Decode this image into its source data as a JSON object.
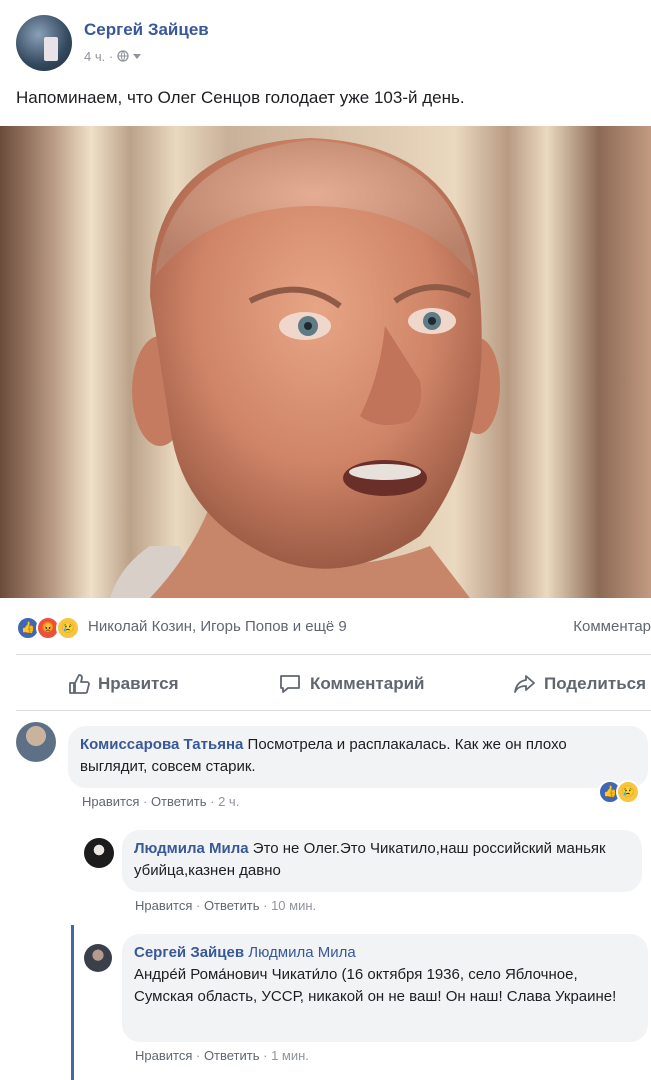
{
  "post": {
    "author": "Сергей Зайцев",
    "time": "4 ч.",
    "privacy_icon": "globe-icon",
    "text": "Напоминаем, что Олег Сенцов голодает уже 103-й день."
  },
  "reactions": {
    "icons": [
      "like-reaction-icon",
      "angry-reaction-icon",
      "sad-reaction-icon"
    ],
    "names": "Николай Козин, Игорь Попов и ещё 9",
    "comments_link": "Комментар"
  },
  "actions": {
    "like": "Нравится",
    "comment": "Комментарий",
    "share": "Поделиться"
  },
  "comments": [
    {
      "author": "Комиссарова Татьяна",
      "text": "Посмотрела и расплакалась. Как же он плохо выглядит, совсем старик.",
      "like": "Нравится",
      "reply": "Ответить",
      "time": "2 ч."
    },
    {
      "author": "Людмила Мила",
      "text": "Это не Олег.Это Чикатило,наш российский маньяк убийца,казнен давно",
      "like": "Нравится",
      "reply": "Ответить",
      "time": "10 мин."
    },
    {
      "author": "Сергей Зайцев",
      "mention": "Людмила Мила",
      "text": "Андре́й Рома́нович Чикати́ло (16 октября 1936, село Яблочное, Сумская область, УССР, никакой он не ваш! Он наш! Слава Украине!",
      "like": "Нравится",
      "reply": "Ответить",
      "time": "1 мин."
    }
  ],
  "colors": {
    "link": "#385898",
    "like_blue": "#4267b2",
    "angry": "#e9513f",
    "sad": "#f7c542"
  }
}
